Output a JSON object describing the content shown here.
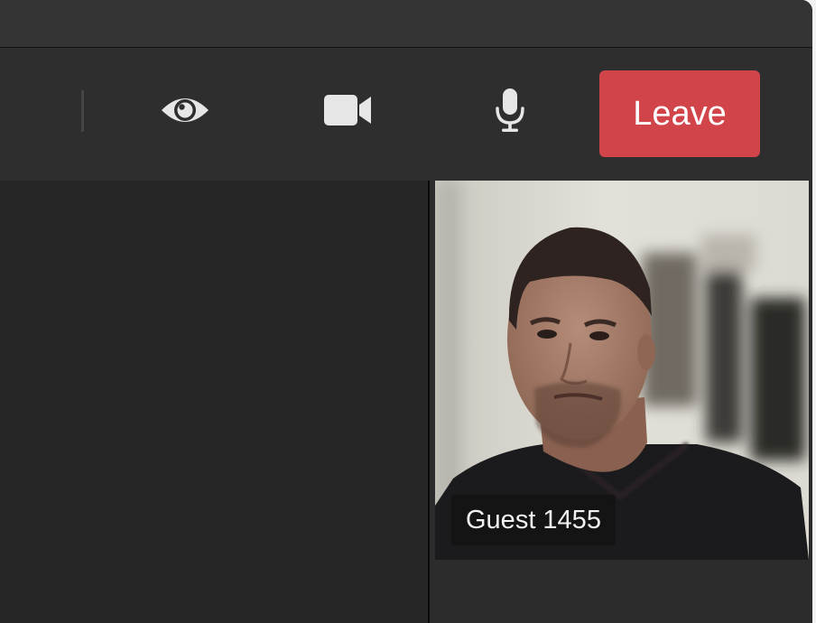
{
  "toolbar": {
    "icons": [
      "eye-icon",
      "video-camera-icon",
      "microphone-icon"
    ],
    "leave_label": "Leave",
    "leave_color": "#d0444a"
  },
  "participants": [
    {
      "name": "Guest 1455"
    }
  ]
}
